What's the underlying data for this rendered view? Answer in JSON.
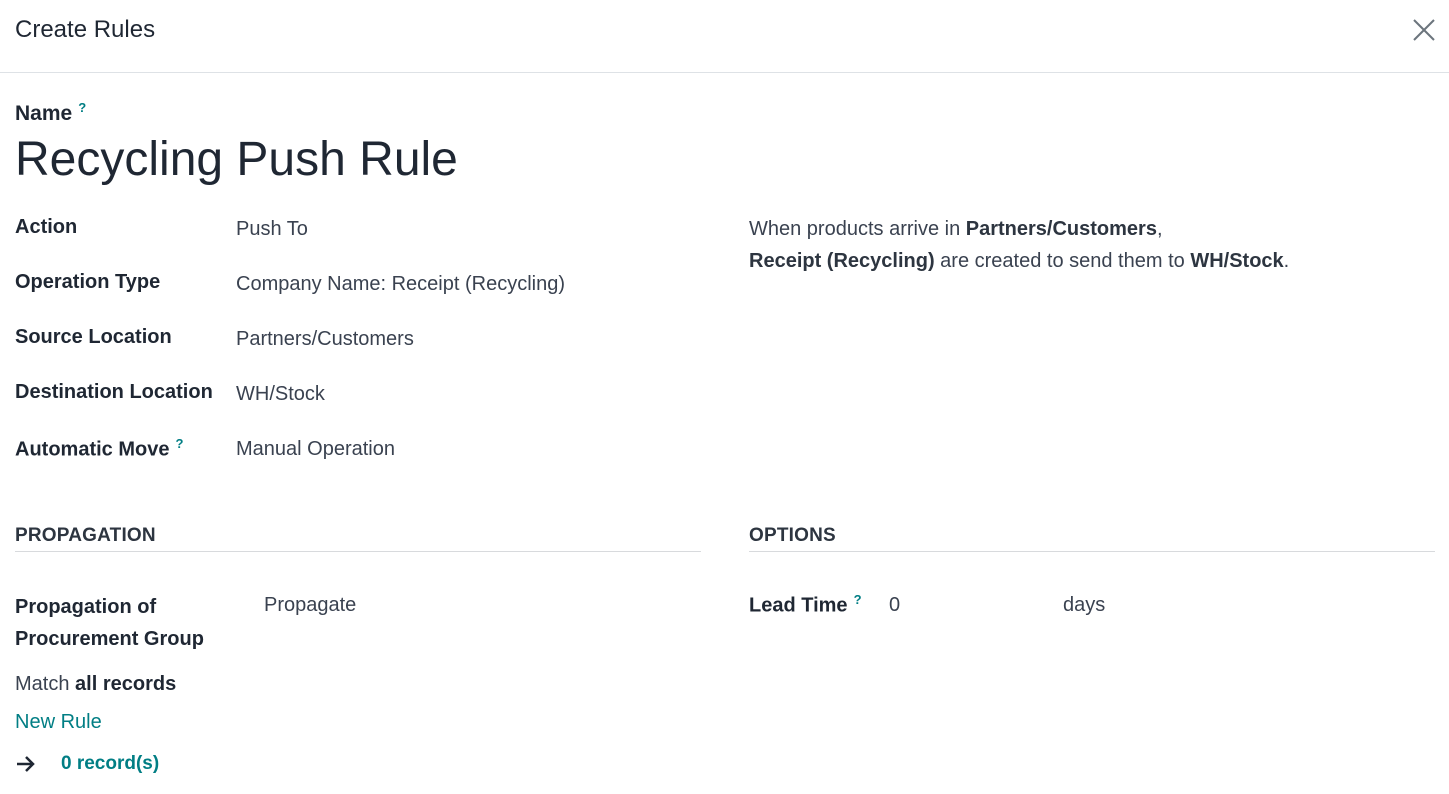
{
  "dialog": {
    "title": "Create Rules",
    "close_icon": "close-icon"
  },
  "name_field": {
    "label": "Name",
    "help": "?",
    "value": "Recycling Push Rule"
  },
  "fields": [
    {
      "label": "Action",
      "value": "Push To"
    },
    {
      "label": "Operation Type",
      "value": "Company Name: Receipt (Recycling)"
    },
    {
      "label": "Source Location",
      "value": "Partners/Customers"
    },
    {
      "label": "Destination Location",
      "value": "WH/Stock"
    },
    {
      "label": "Automatic Move",
      "help": "?",
      "value": "Manual Operation"
    }
  ],
  "description": {
    "p1": "When products arrive in ",
    "b1": "Partners/Customers",
    "p2": ",",
    "b2": "Receipt (Recycling)",
    "p3": " are created to send them to ",
    "b3": "WH/Stock",
    "p4": "."
  },
  "propagation": {
    "title": "PROPAGATION",
    "field_label_line1": "Propagation of",
    "field_label_line2": "Procurement Group",
    "field_value": "Propagate",
    "match_prefix": "Match ",
    "match_bold": "all records",
    "new_rule": "New Rule",
    "arrow_icon": "arrow-right-icon",
    "records": "0 record(s)"
  },
  "options": {
    "title": "OPTIONS",
    "lead_time_label": "Lead Time",
    "help": "?",
    "lead_time_value": "0",
    "lead_time_unit": "days"
  },
  "colors": {
    "accent": "#017e84",
    "text": "#1f2733",
    "border": "#dee2e6"
  }
}
